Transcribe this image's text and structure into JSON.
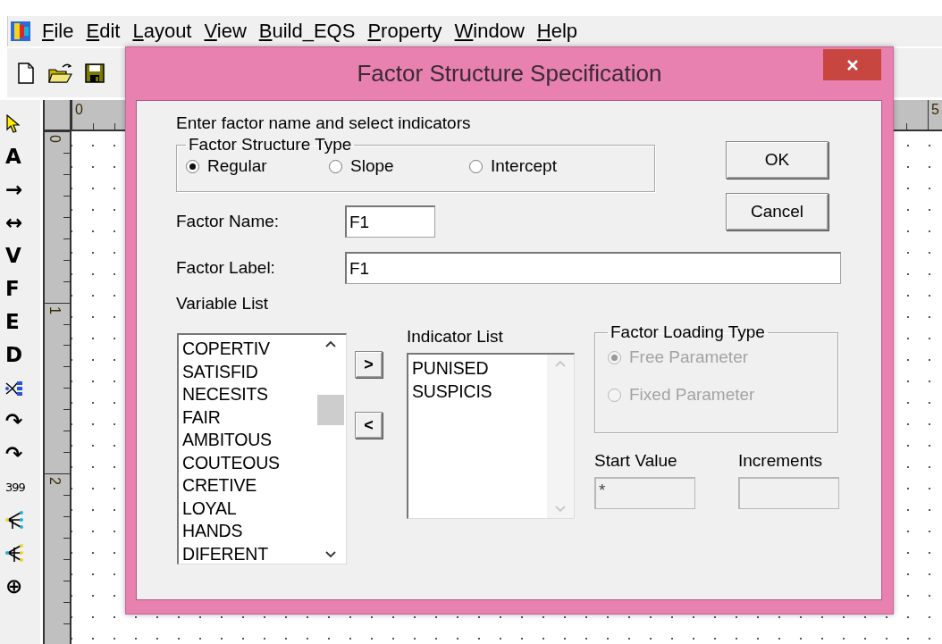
{
  "app": {
    "menu": [
      {
        "label": "File"
      },
      {
        "label": "Edit"
      },
      {
        "label": "Layout"
      },
      {
        "label": "View"
      },
      {
        "label": "Build_EQS"
      },
      {
        "label": "Property"
      },
      {
        "label": "Window"
      },
      {
        "label": "Help"
      }
    ],
    "toolbar": [
      {
        "kind": "new"
      },
      {
        "kind": "open"
      },
      {
        "kind": "save"
      }
    ],
    "tools": [
      {
        "kind": "pointer"
      },
      {
        "kind": "glyph",
        "label": "A"
      },
      {
        "kind": "glyph",
        "label": "→"
      },
      {
        "kind": "glyph",
        "label": "↔"
      },
      {
        "kind": "glyph",
        "label": "V"
      },
      {
        "kind": "glyph",
        "label": "F"
      },
      {
        "kind": "glyph",
        "label": "E"
      },
      {
        "kind": "glyph",
        "label": "D"
      },
      {
        "kind": "tree"
      },
      {
        "kind": "glyph",
        "label": "↷"
      },
      {
        "kind": "glyph",
        "label": "↷"
      },
      {
        "kind": "glyph",
        "label": "399"
      },
      {
        "kind": "fan-out"
      },
      {
        "kind": "fan-in"
      },
      {
        "kind": "glyph",
        "label": "⊕"
      }
    ],
    "ruler": {
      "top_labels": [
        "0",
        "5"
      ],
      "left_labels": [
        "0",
        "1",
        "2"
      ]
    }
  },
  "dialog": {
    "title": "Factor Structure Specification",
    "instruction": "Enter factor name and select indicators",
    "structure_type": {
      "title": "Factor Structure Type",
      "options": [
        {
          "label": "Regular",
          "selected": true
        },
        {
          "label": "Slope",
          "selected": false
        },
        {
          "label": "Intercept",
          "selected": false
        }
      ]
    },
    "buttons": [
      "OK",
      "Cancel"
    ],
    "factor_name": {
      "label": "Factor Name:",
      "value": "F1"
    },
    "factor_label": {
      "label": "Factor Label:",
      "value": "F1"
    },
    "variable_list": {
      "label": "Variable List",
      "items": [
        "COPERTIV",
        "SATISFID",
        "NECESITS",
        "FAIR",
        "AMBITOUS",
        "COUTEOUS",
        "CRETIVE",
        "LOYAL",
        "HANDS",
        "DIFERENT"
      ]
    },
    "move_buttons": [
      ">",
      "<"
    ],
    "indicator_list": {
      "label": "Indicator List",
      "items": [
        "PUNISED",
        "SUSPICIS"
      ]
    },
    "loading_type": {
      "title": "Factor Loading Type",
      "options": [
        {
          "label": "Free Parameter",
          "selected": true,
          "disabled": true
        },
        {
          "label": "Fixed Parameter",
          "selected": false,
          "disabled": true
        }
      ]
    },
    "start_value": {
      "label": "Start Value",
      "value": "*",
      "disabled": true
    },
    "increments": {
      "label": "Increments",
      "disabled": true
    }
  }
}
